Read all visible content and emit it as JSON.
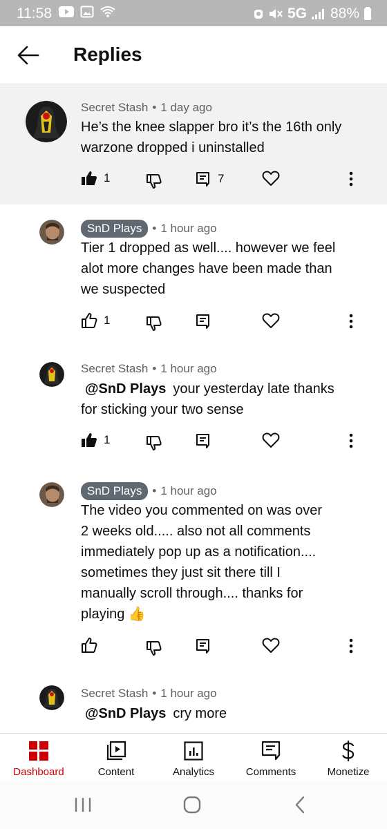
{
  "status": {
    "time": "11:58",
    "network": "5G",
    "battery": "88%"
  },
  "header": {
    "title": "Replies",
    "back_icon": "arrow-left-icon"
  },
  "comments": [
    {
      "author": "Secret Stash",
      "separator": "•",
      "time": "1 day ago",
      "lines": [
        "He’s the knee slapper bro it’s the 16th only",
        "warzone dropped i uninstalled"
      ],
      "likes": "1",
      "replies": "7",
      "liked": true,
      "author_chip": false
    },
    {
      "author": "SnD Plays",
      "separator": "•",
      "time": "1 hour ago",
      "lines": [
        "Tier 1 dropped as well.... however we feel",
        "alot more changes have been made than",
        "we suspected"
      ],
      "likes": "1",
      "liked": false,
      "author_chip": true
    },
    {
      "author": "Secret Stash",
      "separator": "•",
      "time": "1 hour ago",
      "mention": "@SnD Plays",
      "lines": [
        "your yesterday late thanks",
        "for sticking your two sense"
      ],
      "likes": "1",
      "liked": true,
      "author_chip": false
    },
    {
      "author": "SnD Plays",
      "separator": "•",
      "time": "1 hour ago",
      "lines": [
        "The video you commented on was over",
        "2 weeks old..... also not all comments",
        "immediately pop up as a notification....",
        "sometimes they just sit there till I",
        "manually scroll through.... thanks for",
        "playing 👍"
      ],
      "liked": false,
      "author_chip": true
    },
    {
      "author": "Secret Stash",
      "separator": "•",
      "time": "1 hour ago",
      "mention": "@SnD Plays",
      "lines": [
        "cry more"
      ],
      "author_chip": false
    }
  ],
  "bottom_nav": [
    {
      "label": "Dashboard",
      "icon": "dashboard-icon",
      "active": true
    },
    {
      "label": "Content",
      "icon": "content-play-icon"
    },
    {
      "label": "Analytics",
      "icon": "analytics-chart-icon"
    },
    {
      "label": "Comments",
      "icon": "comments-icon"
    },
    {
      "label": "Monetize",
      "icon": "dollar-icon"
    }
  ],
  "colors": {
    "accent": "#cc0000",
    "chip_bg": "#606872",
    "highlight_bg": "#f2f2f2",
    "status_bar": "#b7b7b7"
  }
}
